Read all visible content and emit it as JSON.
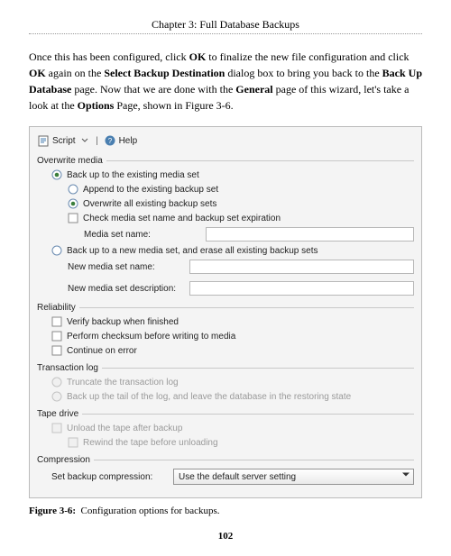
{
  "chapter_title": "Chapter 3: Full Database Backups",
  "body_html_parts": [
    "Once this has been configured, click ",
    "OK",
    " to finalize the new file configuration and click ",
    "OK",
    " again on the ",
    "Select Backup Destination",
    " dialog box to bring you back to the ",
    "Back Up Database",
    " page. Now that we are done with the ",
    "General",
    " page of this wizard, let's take a look at the ",
    "Options",
    " Page, shown in Figure 3-6."
  ],
  "toolbar": {
    "script_label": "Script",
    "help_label": "Help"
  },
  "groups": {
    "overwrite": {
      "title": "Overwrite media",
      "opt_existing": "Back up to the existing media set",
      "opt_append": "Append to the existing backup set",
      "opt_overwrite_all": "Overwrite all existing backup sets",
      "chk_check_media": "Check media set name and backup set expiration",
      "lbl_media_name": "Media set name:",
      "opt_newmedia": "Back up to a new media set, and erase all existing backup sets",
      "lbl_new_media_name": "New media set name:",
      "lbl_new_media_desc": "New media set description:"
    },
    "reliability": {
      "title": "Reliability",
      "chk_verify": "Verify backup when finished",
      "chk_checksum": "Perform checksum before writing to media",
      "chk_continue": "Continue on error"
    },
    "txlog": {
      "title": "Transaction log",
      "opt_truncate": "Truncate the transaction log",
      "opt_backup_tail": "Back up the tail of the log, and leave the database in the restoring state"
    },
    "tape": {
      "title": "Tape drive",
      "chk_unload": "Unload the tape after backup",
      "chk_rewind": "Rewind the tape before unloading"
    },
    "compression": {
      "title": "Compression",
      "lbl_set_compression": "Set backup compression:",
      "combo_value": "Use the default server setting"
    }
  },
  "figure_caption_label": "Figure 3-6:",
  "figure_caption_text": "Configuration options for backups.",
  "page_number": "102"
}
